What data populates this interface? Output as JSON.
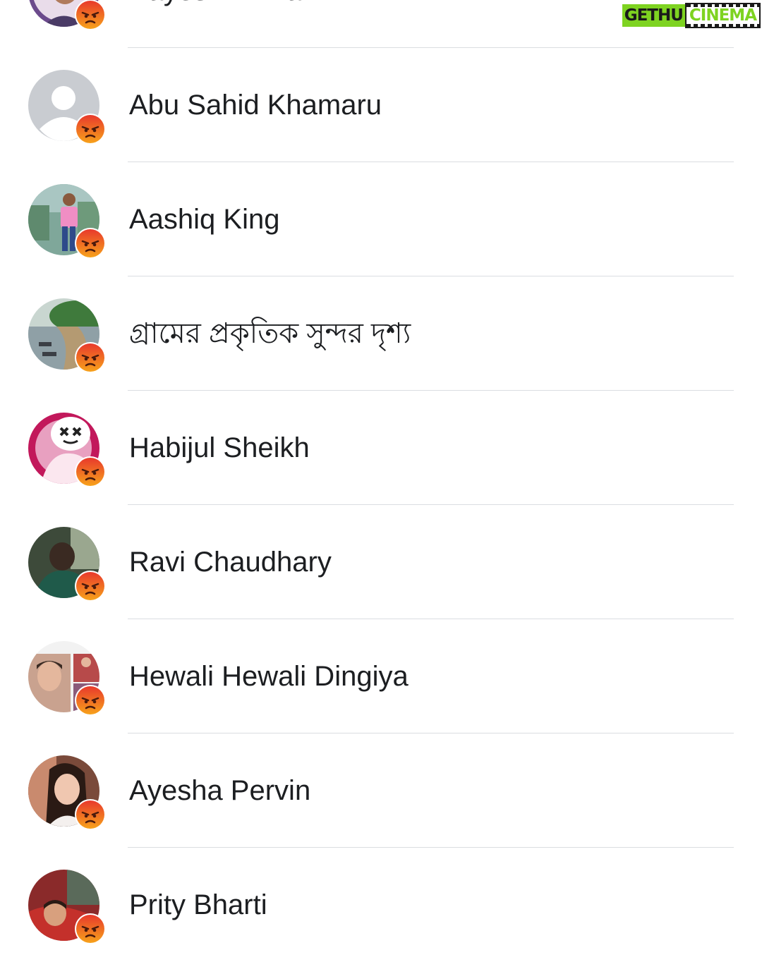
{
  "watermark": {
    "left": "GETHU",
    "right": "CINEMA"
  },
  "reaction": {
    "icon": "angry-reaction-icon",
    "color": "#f26b1d"
  },
  "people": [
    {
      "name": "Aayesh Akmal",
      "avatar": "photo-purple"
    },
    {
      "name": "Abu Sahid Khamaru",
      "avatar": "default-silhouette"
    },
    {
      "name": "Aashiq King",
      "avatar": "photo-pink-shirt"
    },
    {
      "name": "গ্রামের প্রকৃতিক সুন্দর দৃশ্য",
      "avatar": "photo-village-landscape"
    },
    {
      "name": "Habijul Sheikh",
      "avatar": "photo-marshmello"
    },
    {
      "name": "Ravi Chaudhary",
      "avatar": "photo-green-shirt"
    },
    {
      "name": "Hewali Hewali Dingiya",
      "avatar": "photo-collage"
    },
    {
      "name": "Ayesha Pervin",
      "avatar": "photo-woman"
    },
    {
      "name": "Prity Bharti",
      "avatar": "photo-child-red"
    }
  ]
}
